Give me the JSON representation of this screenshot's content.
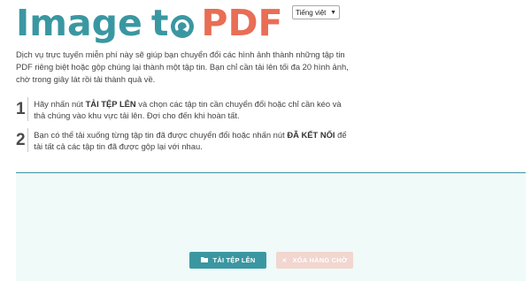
{
  "logo": {
    "part1": "Image",
    "part2": "t",
    "part3": "PDF"
  },
  "language_select": {
    "selected": "Tiếng việt"
  },
  "intro_text": "Dịch vụ trực tuyến miễn phí này sẽ giúp bạn chuyển đổi các hình ảnh thành những tập tin PDF riêng biệt hoặc gộp chúng lại thành một tập tin. Bạn chỉ cần tải lên tối đa 20 hình ảnh, chờ trong giây lát rồi tải thành quả về.",
  "steps": [
    {
      "number": "1",
      "before": "Hãy nhấn nút ",
      "bold": "TẢI TỆP LÊN",
      "after": " và chọn các tập tin cần chuyển đổi hoặc chỉ cần kéo và thả chúng vào khu vực tải lên. Đợi cho đến khi hoàn tất."
    },
    {
      "number": "2",
      "before": "Bạn có thể tải xuống từng tập tin đã được chuyển đổi hoặc nhấn nút ",
      "bold": "ĐÃ KẾT NỐI",
      "after": " để tải tất cả các tập tin đã được gộp lại với nhau."
    }
  ],
  "buttons": {
    "upload_label": "TẢI TỆP LÊN",
    "clear_label": "XÓA HÀNG CHỜ"
  },
  "icons": {
    "upload": "folder-icon",
    "clear": "close-icon",
    "logo": "refresh-arrow-icon"
  },
  "colors": {
    "teal": "#3a97a1",
    "coral": "#e86e55",
    "dropzone_bg": "#effaf9",
    "clear_button_bg": "#f2d6cf"
  }
}
